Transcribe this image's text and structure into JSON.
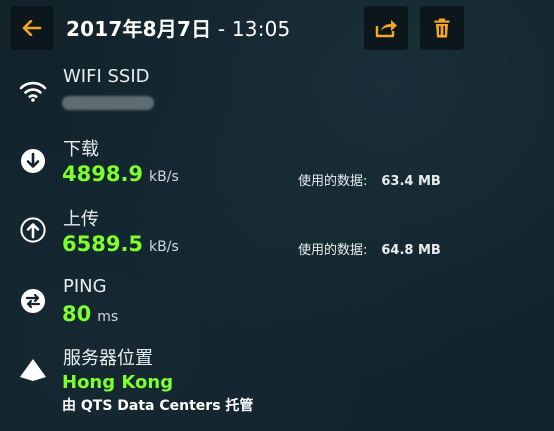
{
  "header": {
    "date": "2017年8月7日",
    "separator": " - ",
    "time": "13:05",
    "back_icon": "arrow-left-icon",
    "share_icon": "share-icon",
    "delete_icon": "trash-icon",
    "accent_color": "#f5a623"
  },
  "wifi": {
    "label": "WIFI SSID",
    "icon": "wifi-icon"
  },
  "download": {
    "label": "下载",
    "value": "4898.9",
    "unit": "kB/s",
    "data_used_label": "使用的数据:",
    "data_used_value": "63.4 MB",
    "icon": "download-arrow-icon"
  },
  "upload": {
    "label": "上传",
    "value": "6589.5",
    "unit": "kB/s",
    "data_used_label": "使用的数据:",
    "data_used_value": "64.8 MB",
    "icon": "upload-arrow-icon"
  },
  "ping": {
    "label": "PING",
    "value": "80",
    "unit": "ms",
    "icon": "ping-icon"
  },
  "server": {
    "label": "服务器位置",
    "location": "Hong Kong",
    "hosted_by": "由 QTS Data Centers 托管",
    "icon": "location-triangle-icon"
  },
  "colors": {
    "value_green": "#7dff2e",
    "background": "#12232c"
  }
}
